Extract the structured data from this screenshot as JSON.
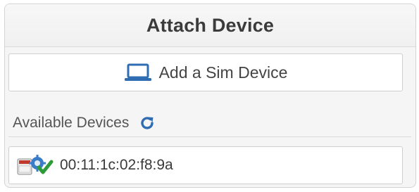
{
  "panel": {
    "title": "Attach Device"
  },
  "add_sim": {
    "label": "Add a Sim Device",
    "icon": "laptop-icon"
  },
  "available": {
    "label": "Available Devices",
    "refresh_icon": "refresh-icon"
  },
  "devices": [
    {
      "id": "00:11:1c:02:f8:9a",
      "icon": "device-connected-icon"
    }
  ],
  "colors": {
    "accent": "#2f6db3",
    "check_green": "#2e9b3a"
  }
}
